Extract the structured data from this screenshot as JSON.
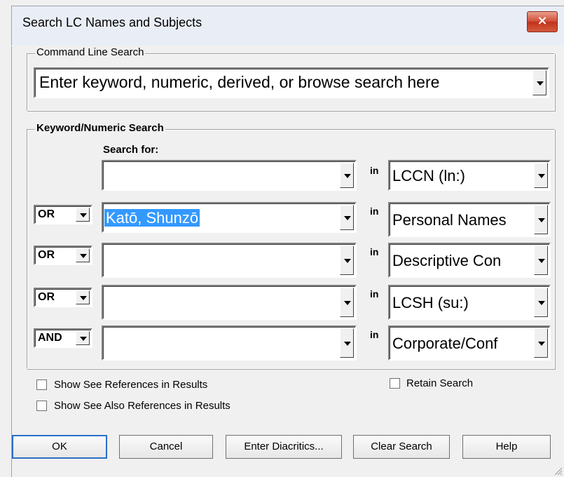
{
  "window": {
    "title": "Search LC Names and Subjects",
    "close_glyph": "×"
  },
  "command_line": {
    "legend": "Command Line Search",
    "value": "Enter keyword, numeric, derived, or browse search here"
  },
  "keyword": {
    "legend": "Keyword/Numeric Search",
    "search_for_label": "Search for:",
    "in_label": "in",
    "rows": [
      {
        "operator": "",
        "term": "",
        "index": "LCCN (ln:)"
      },
      {
        "operator": "OR",
        "term": "Katō, Shunzō",
        "index": "Personal Names"
      },
      {
        "operator": "OR",
        "term": "",
        "index": "Descriptive Con"
      },
      {
        "operator": "OR",
        "term": "",
        "index": "LCSH (su:)"
      },
      {
        "operator": "AND",
        "term": "",
        "index": "Corporate/Conf"
      }
    ]
  },
  "options": {
    "show_see_refs": "Show See References in Results",
    "show_see_also_refs": "Show See Also References in Results",
    "retain_search": "Retain Search"
  },
  "buttons": {
    "ok": "OK",
    "cancel": "Cancel",
    "diacritics": "Enter Diacritics...",
    "clear": "Clear Search",
    "help": "Help"
  }
}
